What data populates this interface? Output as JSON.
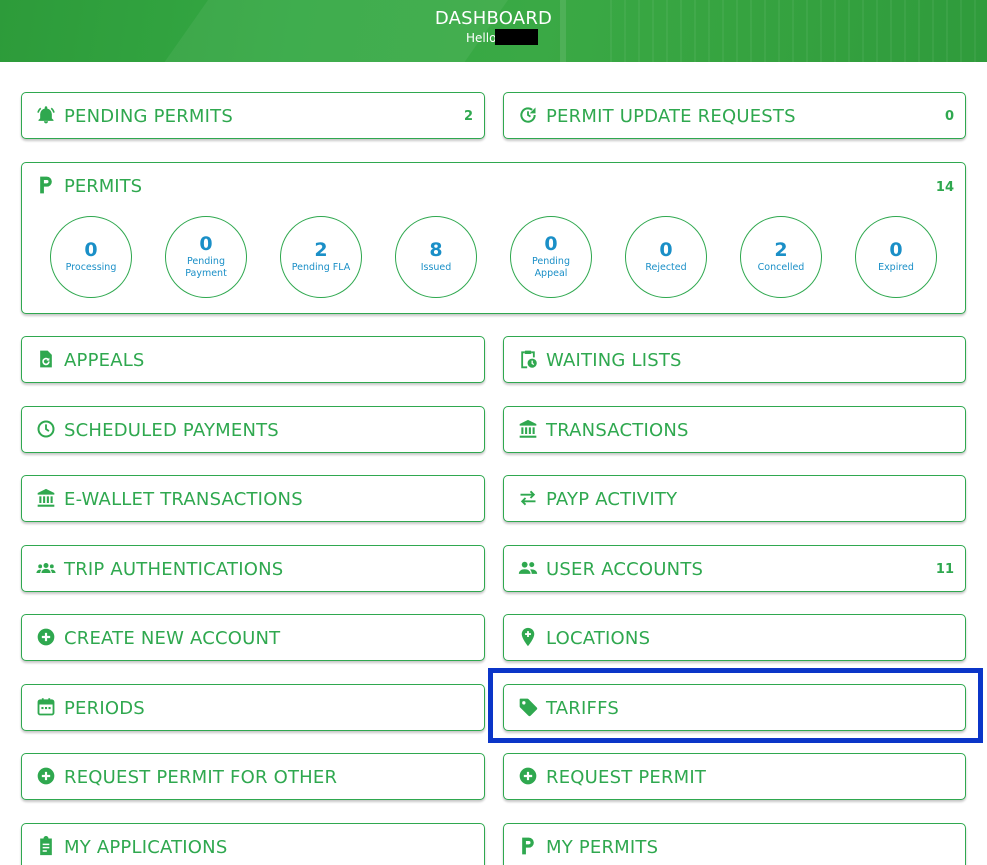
{
  "header": {
    "title": "DASHBOARD",
    "greeting": "Hello",
    "user_name_redacted": true,
    "background_color": "#34a843"
  },
  "colors": {
    "accent": "#2fa84f",
    "count_blue": "#1a8fc7",
    "highlight": "#0b35c8"
  },
  "cards": {
    "pending_permits": {
      "label": "PENDING PERMITS",
      "count": "2",
      "icon": "bell-alert-icon"
    },
    "permit_update_requests": {
      "label": "PERMIT UPDATE REQUESTS",
      "count": "0",
      "icon": "refresh-clock-icon"
    },
    "appeals": {
      "label": "APPEALS",
      "icon": "file-refresh-icon"
    },
    "waiting_lists": {
      "label": "WAITING LISTS",
      "icon": "clipboard-clock-icon"
    },
    "scheduled_payments": {
      "label": "SCHEDULED PAYMENTS",
      "icon": "clock-icon"
    },
    "transactions": {
      "label": "TRANSACTIONS",
      "icon": "bank-icon"
    },
    "ewallet_transactions": {
      "label": "E-WALLET TRANSACTIONS",
      "icon": "bank-icon"
    },
    "payp_activity": {
      "label": "PAYP ACTIVITY",
      "icon": "swap-arrows-icon"
    },
    "trip_authentications": {
      "label": "TRIP AUTHENTICATIONS",
      "icon": "group-icon"
    },
    "user_accounts": {
      "label": "USER ACCOUNTS",
      "count": "11",
      "icon": "users-icon"
    },
    "create_new_account": {
      "label": "CREATE NEW ACCOUNT",
      "icon": "plus-circle-icon"
    },
    "locations": {
      "label": "LOCATIONS",
      "icon": "map-pin-plus-icon"
    },
    "periods": {
      "label": "PERIODS",
      "icon": "calendar-icon"
    },
    "tariffs": {
      "label": "TARIFFS",
      "icon": "tag-icon"
    },
    "request_permit_for_other": {
      "label": "REQUEST PERMIT FOR OTHER",
      "icon": "plus-circle-icon"
    },
    "request_permit": {
      "label": "REQUEST PERMIT",
      "icon": "plus-circle-icon"
    },
    "my_applications": {
      "label": "MY APPLICATIONS",
      "icon": "clipboard-list-icon"
    },
    "my_permits": {
      "label": "MY PERMITS",
      "icon": "letter-p-icon"
    }
  },
  "permits": {
    "label": "PERMITS",
    "count": "14",
    "icon": "letter-p-icon",
    "statuses": [
      {
        "value": "0",
        "caption": "Processing"
      },
      {
        "value": "0",
        "caption": "Pending Payment"
      },
      {
        "value": "2",
        "caption": "Pending FLA"
      },
      {
        "value": "8",
        "caption": "Issued"
      },
      {
        "value": "0",
        "caption": "Pending Appeal"
      },
      {
        "value": "0",
        "caption": "Rejected"
      },
      {
        "value": "2",
        "caption": "Concelled"
      },
      {
        "value": "0",
        "caption": "Expired"
      }
    ]
  }
}
